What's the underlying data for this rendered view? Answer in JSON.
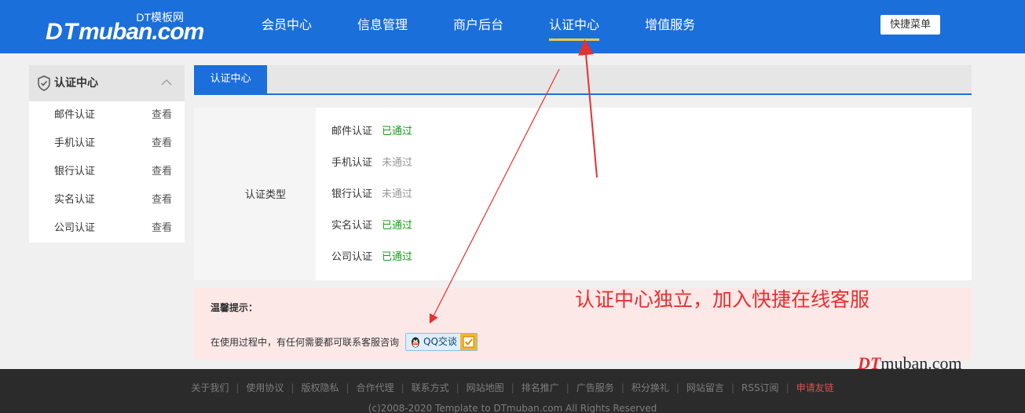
{
  "header": {
    "logo_sub": "DT模板网",
    "logo_dt": "DT",
    "logo_main": "muban.com",
    "nav": [
      "会员中心",
      "信息管理",
      "商户后台",
      "认证中心",
      "增值服务"
    ],
    "active_nav": "认证中心",
    "quick_menu": "快捷菜单"
  },
  "sidebar": {
    "title": "认证中心",
    "items": [
      {
        "label": "邮件认证",
        "action": "查看"
      },
      {
        "label": "手机认证",
        "action": "查看"
      },
      {
        "label": "银行认证",
        "action": "查看"
      },
      {
        "label": "实名认证",
        "action": "查看"
      },
      {
        "label": "公司认证",
        "action": "查看"
      }
    ]
  },
  "main": {
    "tab": "认证中心",
    "type_label": "认证类型",
    "rows": [
      {
        "name": "邮件认证",
        "status": "已通过",
        "ok": true
      },
      {
        "name": "手机认证",
        "status": "未通过",
        "ok": false
      },
      {
        "name": "银行认证",
        "status": "未通过",
        "ok": false
      },
      {
        "name": "实名认证",
        "status": "已通过",
        "ok": true
      },
      {
        "name": "公司认证",
        "status": "已通过",
        "ok": true
      }
    ]
  },
  "notice": {
    "title": "温馨提示：",
    "message": "在使用过程中，有任何需要都可联系客服咨询",
    "qq_label": "QQ交谈"
  },
  "annotation": "认证中心独立，加入快捷在线客服",
  "footer": {
    "links": [
      "关于我们",
      "使用协议",
      "版权隐私",
      "合作代理",
      "联系方式",
      "网站地图",
      "排名推广",
      "广告服务",
      "积分换礼",
      "网站留言",
      "RSS订阅"
    ],
    "highlight_link": "申请友链",
    "copyright": "(c)2008-2020 Template to DTmuban.com All Rights Reserved"
  },
  "watermark": {
    "prefix": "DT",
    "text": "muban.com"
  },
  "colors": {
    "brand": "#1b6fdb",
    "pass": "#1a9b1a",
    "fail": "#999999",
    "annotation": "#e53030"
  }
}
